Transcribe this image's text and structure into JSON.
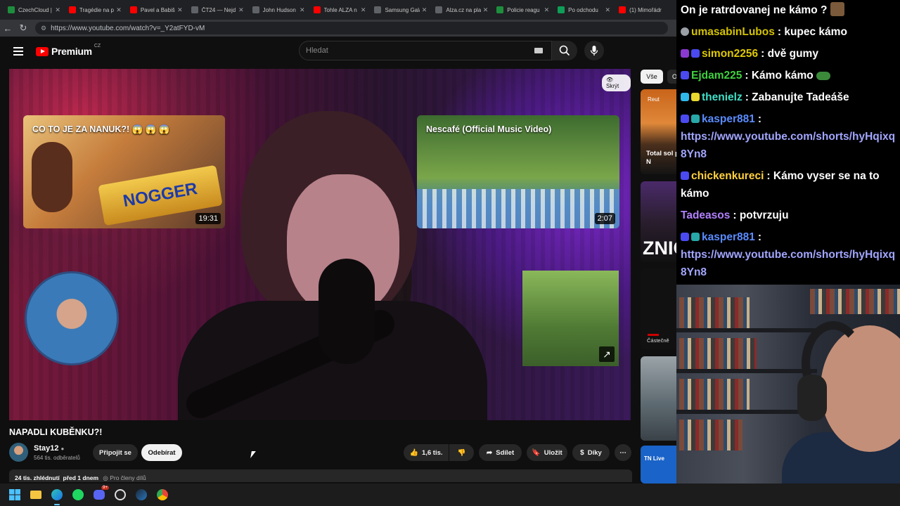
{
  "browser": {
    "tabs": [
      {
        "label": "CzechCloud |",
        "color": "#1e8e3e"
      },
      {
        "label": "Tragédie na p",
        "color": "#ff0000"
      },
      {
        "label": "Pavel a Babiš",
        "color": "#ff0000"
      },
      {
        "label": "ČT24 — Nejd",
        "color": "#5f6368"
      },
      {
        "label": "John Hudson",
        "color": "#5f6368"
      },
      {
        "label": "Tohle ALZA n",
        "color": "#ff0000"
      },
      {
        "label": "Samsung Gala",
        "color": "#5f6368"
      },
      {
        "label": "Alza.cz na pla",
        "color": "#5f6368"
      },
      {
        "label": "Policie reagu",
        "color": "#1e8e3e"
      },
      {
        "label": "Po odchodu",
        "color": "#0f9d58"
      },
      {
        "label": "(1) Mimořádr",
        "color": "#ff0000"
      }
    ],
    "url": "https://www.youtube.com/watch?v=_Y2atFYD-vM"
  },
  "youtube": {
    "logo_text": "Premium",
    "country": "CZ",
    "search_placeholder": "Hledat",
    "video": {
      "hide_label": "Skrýt",
      "endcards": [
        {
          "title": "CO TO JE ZA NANUK?! 😱 😱 😱",
          "duration": "19:31",
          "thumb_text": "NOGGER"
        },
        {
          "title": "Nescafé (Official Music Video)",
          "duration": "2:07"
        }
      ]
    },
    "title": "NAPADLI KUBĚNKU?!",
    "channel": {
      "name": "Stay12",
      "subscribers": "564 tis. odběratelů"
    },
    "buttons": {
      "join": "Připojit se",
      "subscribe": "Odebírat",
      "likes": "1,6 tis.",
      "share": "Sdílet",
      "save": "Uložit",
      "thanks": "Díky"
    },
    "description": {
      "views": "24 tis. zhlédnutí",
      "age": "před 1 dnem",
      "members": "Pro členy dílů"
    },
    "sidebar": {
      "chip_all": "Vše",
      "chip_other": "O",
      "recs": [
        {
          "text": "Total sol parts of N",
          "brand": "Reut"
        },
        {
          "text": "ZNIČ"
        },
        {
          "text": "Částečně"
        },
        {
          "text": ""
        },
        {
          "text": "TN Live"
        }
      ]
    }
  },
  "chat": {
    "messages": [
      {
        "user": "",
        "text": "On je ratrdovanej ne kámo ?",
        "color": "#ffffff"
      },
      {
        "user": "umasabinLubos",
        "text": ": kupec kámo",
        "color": "#d4c200"
      },
      {
        "user": "simon2256",
        "text": ": dvě gumy",
        "color": "#e0c800"
      },
      {
        "user": "Ejdam225",
        "text": ": Kámo kámo",
        "color": "#3fd13f"
      },
      {
        "user": "thenielz",
        "text": ": Zabanujte Tadeáše",
        "color": "#40e0c8"
      },
      {
        "user": "kasper881",
        "text": ":",
        "color": "#5a8cff",
        "link": "https://www.youtube.com/shorts/hyHqixq8Yn8"
      },
      {
        "user": "chickenkureci",
        "text": ": Kámo vyser se na to kámo",
        "color": "#ffd040"
      },
      {
        "user": "Tadeasos",
        "text": ": potvrzuju",
        "color": "#b280ff"
      },
      {
        "user": "kasper881",
        "text": ":",
        "color": "#5a8cff",
        "link": "https://www.youtube.com/shorts/hyHqixq8Yn8"
      }
    ]
  },
  "taskbar": {
    "apps": [
      "windows-start",
      "file-explorer",
      "edge",
      "spotify",
      "discord",
      "obs",
      "steam",
      "chrome"
    ],
    "discord_badge": "9+"
  }
}
